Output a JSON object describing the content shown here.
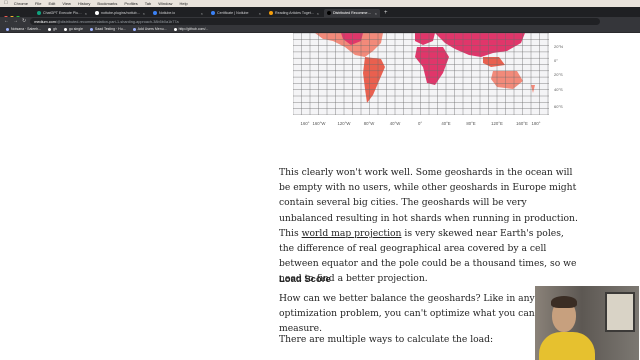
{
  "menubar": {
    "apple_icon": "apple-icon",
    "items": [
      "Chrome",
      "File",
      "Edit",
      "View",
      "History",
      "Bookmarks",
      "Profiles",
      "Tab",
      "Window",
      "Help"
    ]
  },
  "tabs": [
    {
      "label": "ChatGPT Execute Plugin · Er..."
    },
    {
      "label": "nottube-plugins/nottube/nc..."
    },
    {
      "label": "Notlube.io"
    },
    {
      "label": "Certificate | Notlube"
    },
    {
      "label": "Reading Articles Together · Li..."
    },
    {
      "label": "Distributed Recommendatio..."
    }
  ],
  "active_tab_index": 5,
  "address": {
    "host": "medium.com",
    "path": "/@distributed-recommendation-part-1-sharding-approach-38b5b0a1b77a"
  },
  "bookmarks": [
    {
      "label": "Notsana · Saleeh..."
    },
    {
      "label": "gh"
    },
    {
      "label": "go single"
    },
    {
      "label": "Saad Testing · Hu..."
    },
    {
      "label": "Add Users Menu..."
    },
    {
      "label": "http://github.com/..."
    }
  ],
  "map": {
    "lat_labels": [
      "20°N",
      "0°",
      "20°S",
      "40°S",
      "60°S"
    ],
    "lon_labels": [
      "160°",
      "160°W",
      "120°W",
      "80°W",
      "40°W",
      "0°",
      "40°E",
      "80°E",
      "120°E",
      "160°E",
      "180°"
    ],
    "land_color": "#c9c9c9",
    "grid_color": "#6a6a6a",
    "hot_color": "#e0366a",
    "warm_color": "#f28a7a"
  },
  "article": {
    "p1_a": "This clearly won't work well. Some geoshards in the ocean will be empty with no users, while other geoshards in Europe might contain several big cities. The geoshards will be very unbalanced resulting in hot shards when running in production. This ",
    "p1_link": "world map projection",
    "p1_b": " is very skewed near Earth's poles, the difference of real geographical area covered by a cell between equator and the pole could be a thousand times, so we need to find a better projection.",
    "heading": "Load Score",
    "p2": "How can we better balance the geoshards? Like in any type of optimization problem, you can't optimize what you can't measure.",
    "p3": "There are multiple ways to calculate the load:"
  }
}
